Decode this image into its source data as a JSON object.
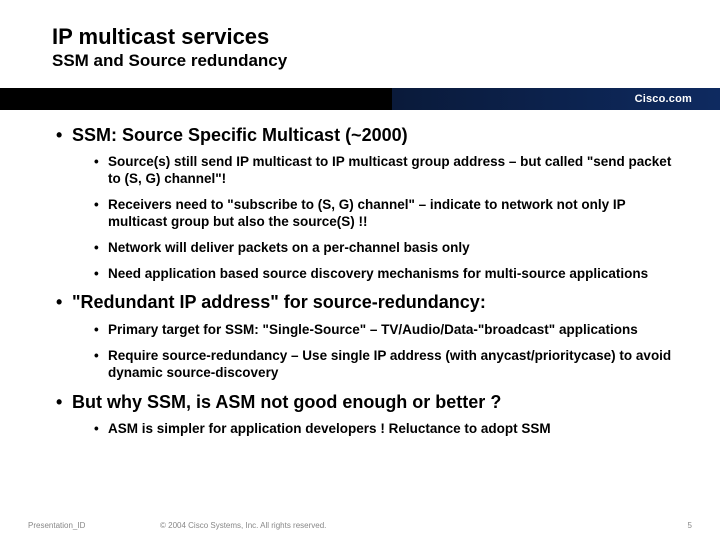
{
  "header": {
    "title": "IP multicast services",
    "subtitle": "SSM and Source redundancy",
    "brand": "Cisco.com"
  },
  "bullets": [
    {
      "text": "SSM: Source Specific Multicast (~2000)",
      "sub": [
        "Source(s) still send IP multicast to IP multicast group address – but called \"send packet to (S, G) channel\"!",
        "Receivers need to \"subscribe to (S, G) channel\" – indicate to network not only IP multicast group but also the source(S) !!",
        "Network will deliver packets on a per-channel basis only",
        "Need application based source discovery mechanisms for multi-source applications"
      ]
    },
    {
      "text": "\"Redundant IP address\" for source-redundancy:",
      "sub": [
        "Primary target for SSM: \"Single-Source\" – TV/Audio/Data-\"broadcast\" applications",
        "Require source-redundancy – Use single IP address (with anycast/prioritycase) to avoid dynamic source-discovery"
      ]
    },
    {
      "text": "But why SSM, is ASM not good enough or better ?",
      "sub": [
        "ASM is simpler for application developers ! Reluctance to adopt SSM"
      ]
    }
  ],
  "footer": {
    "id": "Presentation_ID",
    "copyright": "© 2004 Cisco Systems, Inc. All rights reserved.",
    "page": "5"
  }
}
